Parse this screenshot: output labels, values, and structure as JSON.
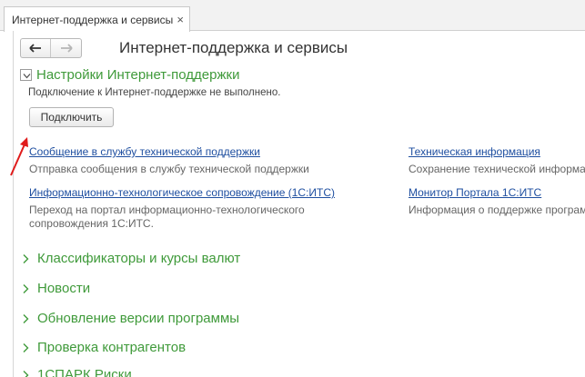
{
  "tab": {
    "title": "Интернет-поддержка и сервисы",
    "close": "×"
  },
  "nav": {
    "back": "🡐",
    "forward": "🡒"
  },
  "page_title": "Интернет-поддержка и сервисы",
  "settings_group": {
    "title": "Настройки Интернет-поддержки",
    "status": "Подключение к Интернет-поддержке не выполнено.",
    "connect_button": "Подключить"
  },
  "links": [
    {
      "label": "Сообщение в службу технической поддержки",
      "desc": [
        "Отправка сообщения в службу технической поддержки"
      ]
    },
    {
      "label": "Информационно-технологическое сопровождение (1С:ИТС)",
      "desc": [
        "Переход на портал информационно-технологического",
        "сопровождения 1С:ИТС."
      ]
    },
    {
      "label": "Техническая информация",
      "desc": [
        "Сохранение технической информа"
      ]
    },
    {
      "label": "Монитор Портала 1С:ИТС",
      "desc": [
        "Информация о поддержке програм"
      ]
    }
  ],
  "sections": [
    "Классификаторы и курсы валют",
    "Новости",
    "Обновление версии программы",
    "Проверка контрагентов",
    "1СПАРК Риски"
  ],
  "colors": {
    "accent_green": "#3f9a3a",
    "link_blue": "#1f4fa0",
    "annotation_red": "#e01b1b"
  }
}
